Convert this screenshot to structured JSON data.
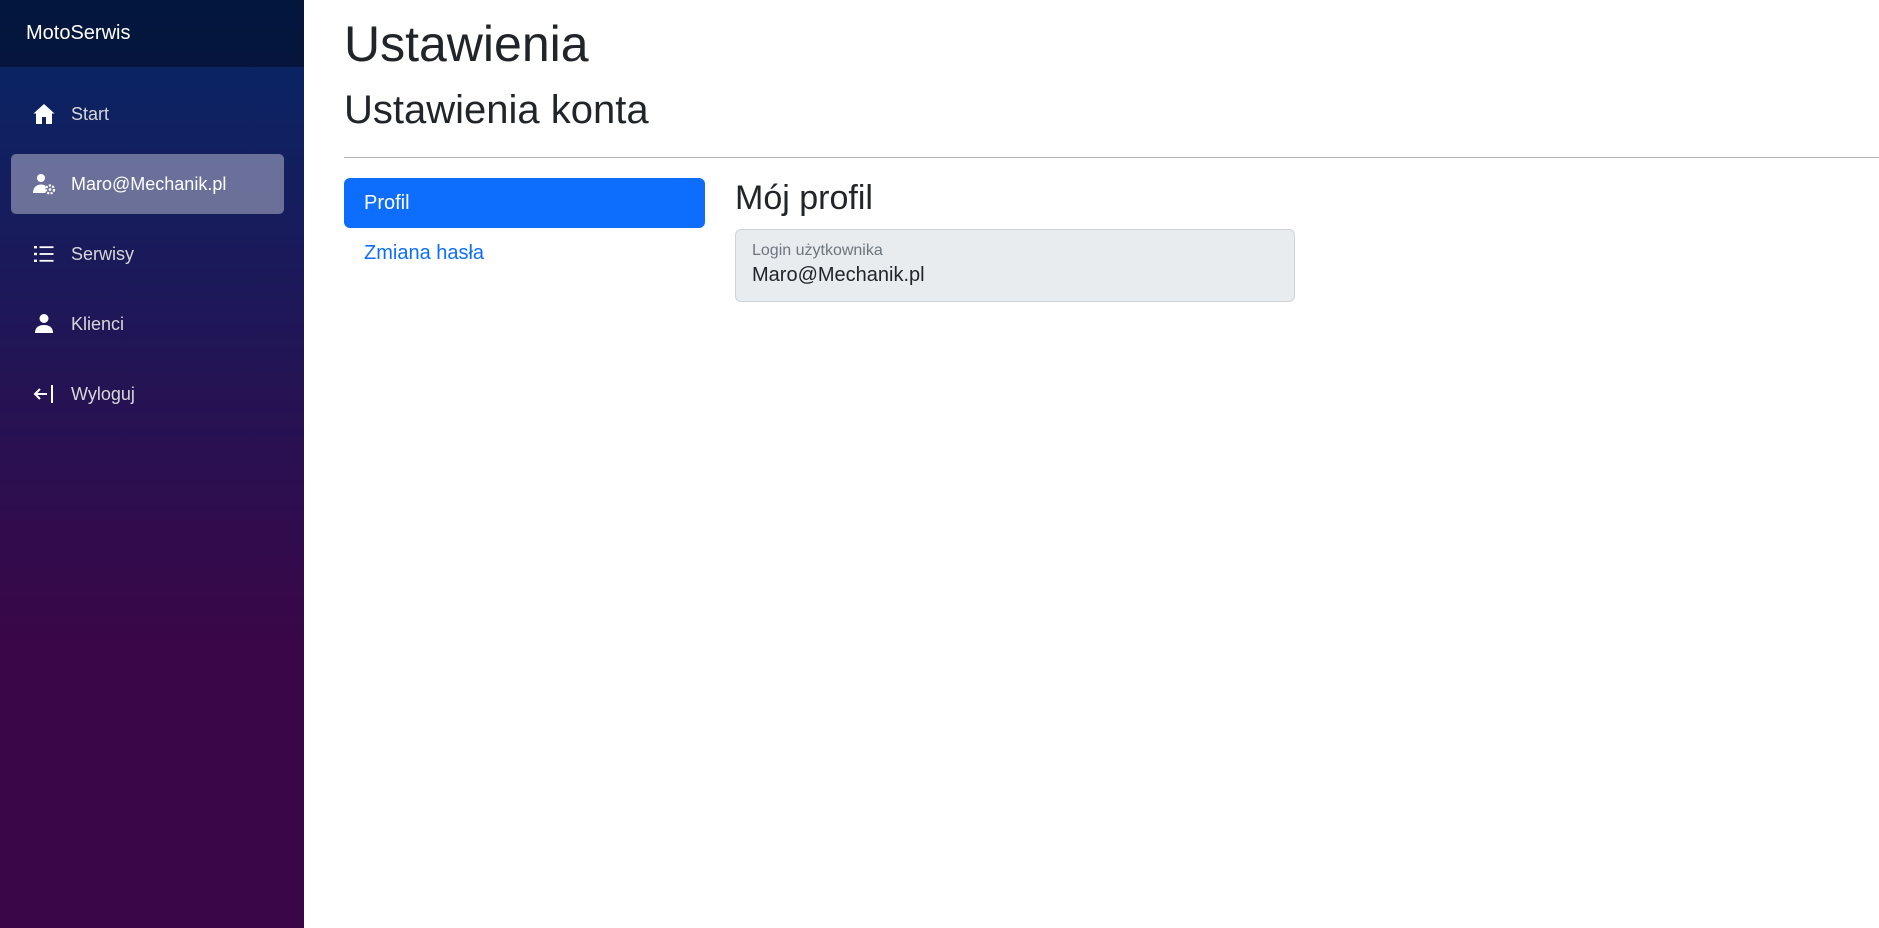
{
  "sidebar": {
    "brand": "MotoSerwis",
    "items": [
      {
        "label": "Start",
        "icon": "home-icon",
        "active": false
      },
      {
        "label": "Maro@Mechanik.pl",
        "icon": "user-gear-icon",
        "active": true
      },
      {
        "label": "Serwisy",
        "icon": "list-icon",
        "active": false
      },
      {
        "label": "Klienci",
        "icon": "person-icon",
        "active": false
      },
      {
        "label": "Wyloguj",
        "icon": "logout-icon",
        "active": false
      }
    ]
  },
  "main": {
    "title": "Ustawienia",
    "subtitle": "Ustawienia konta",
    "subnav": [
      {
        "label": "Profil",
        "active": true
      },
      {
        "label": "Zmiana hasła",
        "active": false
      }
    ],
    "profile": {
      "heading": "Mój profil",
      "login_label": "Login użytkownika",
      "login_value": "Maro@Mechanik.pl"
    }
  },
  "colors": {
    "sidebar_top": "#052767",
    "sidebar_bottom": "#3a0647",
    "accent": "#0d6efd",
    "field_bg": "#e9ecef"
  }
}
